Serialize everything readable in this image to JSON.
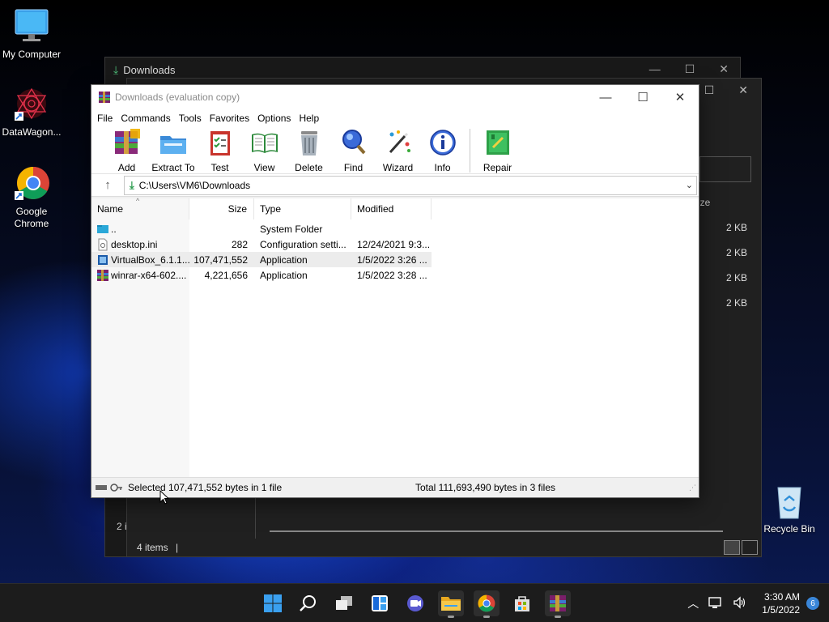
{
  "desktop": {
    "icons": [
      {
        "label": "My Computer",
        "icon": "monitor-icon"
      },
      {
        "label": "DataWagon...",
        "icon": "datawagon-icon"
      },
      {
        "label": "Google Chrome",
        "icon": "chrome-icon"
      },
      {
        "label": "Recycle Bin",
        "icon": "recycle-bin-icon"
      }
    ]
  },
  "explorer": {
    "title": "Downloads",
    "sizes_header": "ize",
    "sizes": [
      "2 KB",
      "2 KB",
      "2 KB",
      "2 KB"
    ],
    "status": "4 items",
    "status_bg": "2 i"
  },
  "winrar": {
    "title": "Downloads (evaluation copy)",
    "menu": [
      "File",
      "Commands",
      "Tools",
      "Favorites",
      "Options",
      "Help"
    ],
    "toolbar": [
      {
        "label": "Add",
        "icon": "add-archive-icon"
      },
      {
        "label": "Extract To",
        "icon": "extract-folder-icon"
      },
      {
        "label": "Test",
        "icon": "test-clipboard-icon"
      },
      {
        "label": "View",
        "icon": "view-book-icon"
      },
      {
        "label": "Delete",
        "icon": "trash-can-icon"
      },
      {
        "label": "Find",
        "icon": "magnifier-icon"
      },
      {
        "label": "Wizard",
        "icon": "magic-wand-icon"
      },
      {
        "label": "Info",
        "icon": "info-icon"
      },
      {
        "label": "Repair",
        "icon": "repair-kit-icon"
      }
    ],
    "address": "C:\\Users\\VM6\\Downloads",
    "columns": [
      "Name",
      "Size",
      "Type",
      "Modified"
    ],
    "files": [
      {
        "name": "..",
        "size": "",
        "type": "System Folder",
        "modified": "",
        "icon": "parent-folder-icon"
      },
      {
        "name": "desktop.ini",
        "size": "282",
        "type": "Configuration setti...",
        "modified": "12/24/2021 9:3...",
        "icon": "ini-file-icon"
      },
      {
        "name": "VirtualBox_6.1.1...",
        "size": "107,471,552",
        "type": "Application",
        "modified": "1/5/2022 3:26 ...",
        "icon": "virtualbox-file-icon"
      },
      {
        "name": "winrar-x64-602....",
        "size": "4,221,656",
        "type": "Application",
        "modified": "1/5/2022 3:28 ...",
        "icon": "winrar-file-icon"
      }
    ],
    "status_selected": "Selected 107,471,552 bytes in 1 file",
    "status_total": "Total 111,693,490 bytes in 3 files"
  },
  "taskbar": {
    "time": "3:30 AM",
    "date": "1/5/2022",
    "notifications": "6"
  },
  "colors": {
    "accent": "#2f9e52",
    "selection": "#ececec",
    "taskbar": "#1c1c1c"
  }
}
